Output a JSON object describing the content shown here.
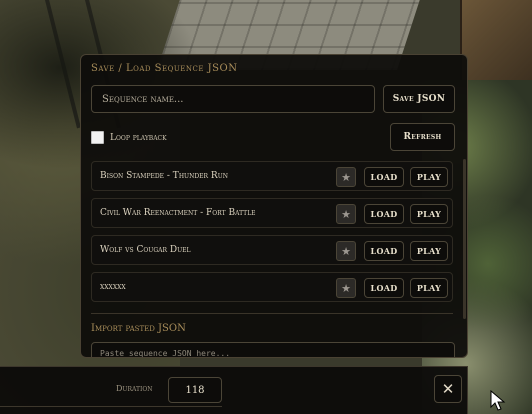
{
  "panel": {
    "title": "Save / Load Sequence JSON",
    "name_input": {
      "placeholder": "Sequence name...",
      "value": ""
    },
    "save_label": "Save JSON",
    "loop_label": "Loop playback",
    "loop_checked": false,
    "refresh_label": "Refresh"
  },
  "sequences": [
    {
      "name": "Bison Stampede - Thunder Run",
      "star": "★",
      "load": "LOAD",
      "play": "PLAY"
    },
    {
      "name": "Civil War Reenactment - Fort Battle",
      "star": "★",
      "load": "LOAD",
      "play": "PLAY"
    },
    {
      "name": "Wolf vs Cougar Duel",
      "star": "★",
      "load": "LOAD",
      "play": "PLAY"
    },
    {
      "name": "xxxxxx",
      "star": "★",
      "load": "LOAD",
      "play": "PLAY"
    }
  ],
  "import": {
    "title": "Import pasted JSON",
    "placeholder": "Paste sequence JSON here..."
  },
  "bottom_bar": {
    "duration_label": "Duration",
    "duration_value": "118",
    "close_symbol": "✕"
  },
  "icons": {
    "star": "star-icon",
    "close": "close-icon",
    "cursor": "mouse-cursor-icon"
  },
  "colors": {
    "panel_bg": "#0e0d0b",
    "accent": "#a88d5a",
    "text": "#ddd4c0",
    "border": "#4b4537"
  }
}
